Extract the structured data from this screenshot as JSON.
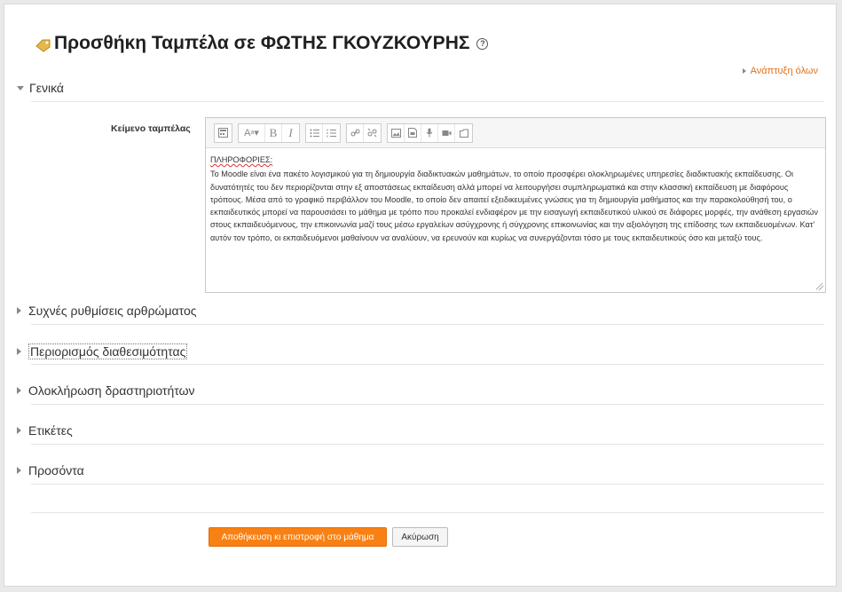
{
  "page": {
    "title": "Προσθήκη Ταμπέλα σε ΦΩΤΗΣ ΓΚΟΥΖΚΟΥΡΗΣ",
    "help_icon": "question-circle-icon",
    "tag_icon": "tag-icon",
    "expand_all": "Ανάπτυξη όλων"
  },
  "sections": {
    "general": "Γενικά",
    "common_settings": "Συχνές ρυθμίσεις αρθρώματος",
    "restrict_access": "Περιορισμός διαθεσιμότητας",
    "completion": "Ολοκλήρωση δραστηριοτήτων",
    "tags": "Ετικέτες",
    "competencies": "Προσόντα"
  },
  "editor": {
    "label": "Κείμενο ταμπέλας",
    "toolbar": [
      "toggle-toolbar",
      "font-style",
      "bold",
      "italic",
      "unordered-list",
      "ordered-list",
      "link",
      "unlink",
      "image",
      "media",
      "record-audio",
      "record-video",
      "manage-files"
    ],
    "heading": "ΠΛΗΡΟΦΟΡΙΕΣ:",
    "body": "Το Moodle είναι ένα πακέτο λογισμικού για τη δημιουργία διαδικτυακών μαθημάτων, το οποίο προσφέρει ολοκληρωμένες υπηρεσίες διαδικτυακής εκπαίδευσης. Οι δυνατότητές του δεν περιορίζονται στην εξ αποστάσεως εκπαίδευση αλλά μπορεί να λειτουργήσει συμπληρωματικά και στην κλασσική εκπαίδευση με διαφόρους τρόπους. Μέσα από το γραφικό περιβάλλον του Moodle, το οποίο δεν απαιτεί εξειδικευμένες γνώσεις για τη δημιουργία μαθήματος και την παρακολούθησή του, ο εκπαιδευτικός μπορεί να παρουσιάσει το μάθημα με τρόπο που προκαλεί ενδιαφέρον με την εισαγωγή εκπαιδευτικού υλικού σε διάφορες μορφές, την ανάθεση εργασιών στους εκπαιδευόμενους, την επικοινωνία μαζί τους μέσω εργαλείων ασύγχρονης ή σύγχρονης επικοινωνίας και την αξιολόγηση της επίδοσης των εκπαιδευομένων. Κατ' αυτόν τον τρόπο, οι εκπαιδευόμενοι μαθαίνουν να αναλύουν, να ερευνούν και κυρίως να συνεργάζονται τόσο με τους εκπαιδευτικούς όσο και μεταξύ τους."
  },
  "buttons": {
    "save": "Αποθήκευση κι επιστροφή στο μάθημα",
    "cancel": "Ακύρωση"
  },
  "colors": {
    "accent": "#f98012",
    "link": "#e0701c"
  }
}
